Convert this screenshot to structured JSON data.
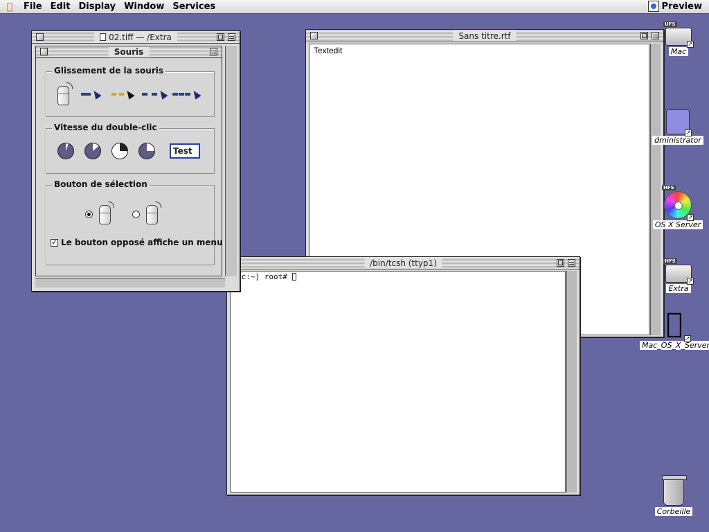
{
  "menubar": {
    "items": [
      "File",
      "Edit",
      "Display",
      "Window",
      "Services"
    ],
    "active_app": "Preview"
  },
  "preview_window": {
    "title": "02.tiff — /Extra",
    "panel": {
      "title": "Souris",
      "tracking": {
        "label": "Glissement de la souris",
        "selected_index": 1
      },
      "double_click": {
        "label": "Vitesse du double-clic",
        "test_label": "Test"
      },
      "button": {
        "label": "Bouton de sélection",
        "selected": "left",
        "checkbox_label": "Le bouton opposé affiche un menu",
        "checkbox_checked": true
      }
    }
  },
  "textedit_window": {
    "title": "Sans titre.rtf",
    "body": "Textedit"
  },
  "terminal_window": {
    "title": "/bin/tcsh  (ttyp1)",
    "prompt": "ac:~] root# "
  },
  "desktop_icons": [
    {
      "label": "Mac",
      "tag": "UFS"
    },
    {
      "label": "dministrator"
    },
    {
      "label": "OS X Server",
      "tag": "HFS"
    },
    {
      "label": "Extra",
      "tag": "HFS"
    },
    {
      "label": "Mac_OS_X_Server"
    },
    {
      "label": "Corbeille"
    }
  ]
}
